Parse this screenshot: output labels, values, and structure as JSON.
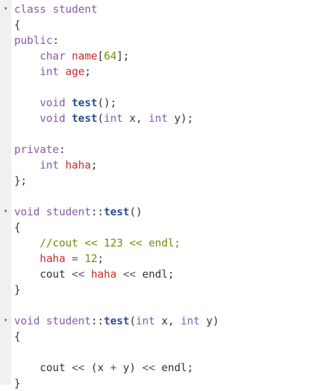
{
  "fold_icon": "▾",
  "lines": [
    [
      {
        "t": "class ",
        "c": "kw"
      },
      {
        "t": "student",
        "c": "cls"
      }
    ],
    [
      {
        "t": "{",
        "c": ""
      }
    ],
    [
      {
        "t": "public",
        "c": "kw"
      },
      {
        "t": ":",
        "c": ""
      }
    ],
    [
      {
        "t": "    ",
        "c": ""
      },
      {
        "t": "char",
        "c": "type"
      },
      {
        "t": " ",
        "c": ""
      },
      {
        "t": "name",
        "c": "var"
      },
      {
        "t": "[",
        "c": ""
      },
      {
        "t": "64",
        "c": "num"
      },
      {
        "t": "];",
        "c": ""
      }
    ],
    [
      {
        "t": "    ",
        "c": ""
      },
      {
        "t": "int",
        "c": "type"
      },
      {
        "t": " ",
        "c": ""
      },
      {
        "t": "age",
        "c": "var"
      },
      {
        "t": ";",
        "c": ""
      }
    ],
    [],
    [
      {
        "t": "    ",
        "c": ""
      },
      {
        "t": "void",
        "c": "type"
      },
      {
        "t": " ",
        "c": ""
      },
      {
        "t": "test",
        "c": "fn"
      },
      {
        "t": "();",
        "c": ""
      }
    ],
    [
      {
        "t": "    ",
        "c": ""
      },
      {
        "t": "void",
        "c": "type"
      },
      {
        "t": " ",
        "c": ""
      },
      {
        "t": "test",
        "c": "fn"
      },
      {
        "t": "(",
        "c": ""
      },
      {
        "t": "int",
        "c": "type"
      },
      {
        "t": " x, ",
        "c": ""
      },
      {
        "t": "int",
        "c": "type"
      },
      {
        "t": " y);",
        "c": ""
      }
    ],
    [],
    [
      {
        "t": "private",
        "c": "kw"
      },
      {
        "t": ":",
        "c": ""
      }
    ],
    [
      {
        "t": "    ",
        "c": ""
      },
      {
        "t": "int",
        "c": "type"
      },
      {
        "t": " ",
        "c": ""
      },
      {
        "t": "haha",
        "c": "var"
      },
      {
        "t": ";",
        "c": ""
      }
    ],
    [
      {
        "t": "};",
        "c": ""
      }
    ],
    [],
    [
      {
        "t": "void",
        "c": "type"
      },
      {
        "t": " ",
        "c": ""
      },
      {
        "t": "student",
        "c": "cls"
      },
      {
        "t": "::",
        "c": ""
      },
      {
        "t": "test",
        "c": "fn"
      },
      {
        "t": "()",
        "c": ""
      }
    ],
    [
      {
        "t": "{",
        "c": ""
      }
    ],
    [
      {
        "t": "    ",
        "c": ""
      },
      {
        "t": "//cout << 123 << endl;",
        "c": "cm"
      }
    ],
    [
      {
        "t": "    ",
        "c": ""
      },
      {
        "t": "haha",
        "c": "var"
      },
      {
        "t": " = ",
        "c": "op"
      },
      {
        "t": "12",
        "c": "num"
      },
      {
        "t": ";",
        "c": ""
      }
    ],
    [
      {
        "t": "    cout ",
        "c": ""
      },
      {
        "t": "<<",
        "c": "op"
      },
      {
        "t": " ",
        "c": ""
      },
      {
        "t": "haha",
        "c": "var"
      },
      {
        "t": " ",
        "c": ""
      },
      {
        "t": "<<",
        "c": "op"
      },
      {
        "t": " endl;",
        "c": ""
      }
    ],
    [
      {
        "t": "}",
        "c": ""
      }
    ],
    [],
    [
      {
        "t": "void",
        "c": "type"
      },
      {
        "t": " ",
        "c": ""
      },
      {
        "t": "student",
        "c": "cls"
      },
      {
        "t": "::",
        "c": ""
      },
      {
        "t": "test",
        "c": "fn"
      },
      {
        "t": "(",
        "c": ""
      },
      {
        "t": "int",
        "c": "type"
      },
      {
        "t": " x, ",
        "c": ""
      },
      {
        "t": "int",
        "c": "type"
      },
      {
        "t": " y)",
        "c": ""
      }
    ],
    [
      {
        "t": "{",
        "c": ""
      }
    ],
    [],
    [
      {
        "t": "    cout ",
        "c": ""
      },
      {
        "t": "<<",
        "c": "op"
      },
      {
        "t": " (x ",
        "c": ""
      },
      {
        "t": "+",
        "c": "op"
      },
      {
        "t": " y) ",
        "c": ""
      },
      {
        "t": "<<",
        "c": "op"
      },
      {
        "t": " endl;",
        "c": ""
      }
    ],
    [
      {
        "t": "}",
        "c": ""
      }
    ]
  ],
  "fold_lines": [
    0,
    13,
    20
  ]
}
